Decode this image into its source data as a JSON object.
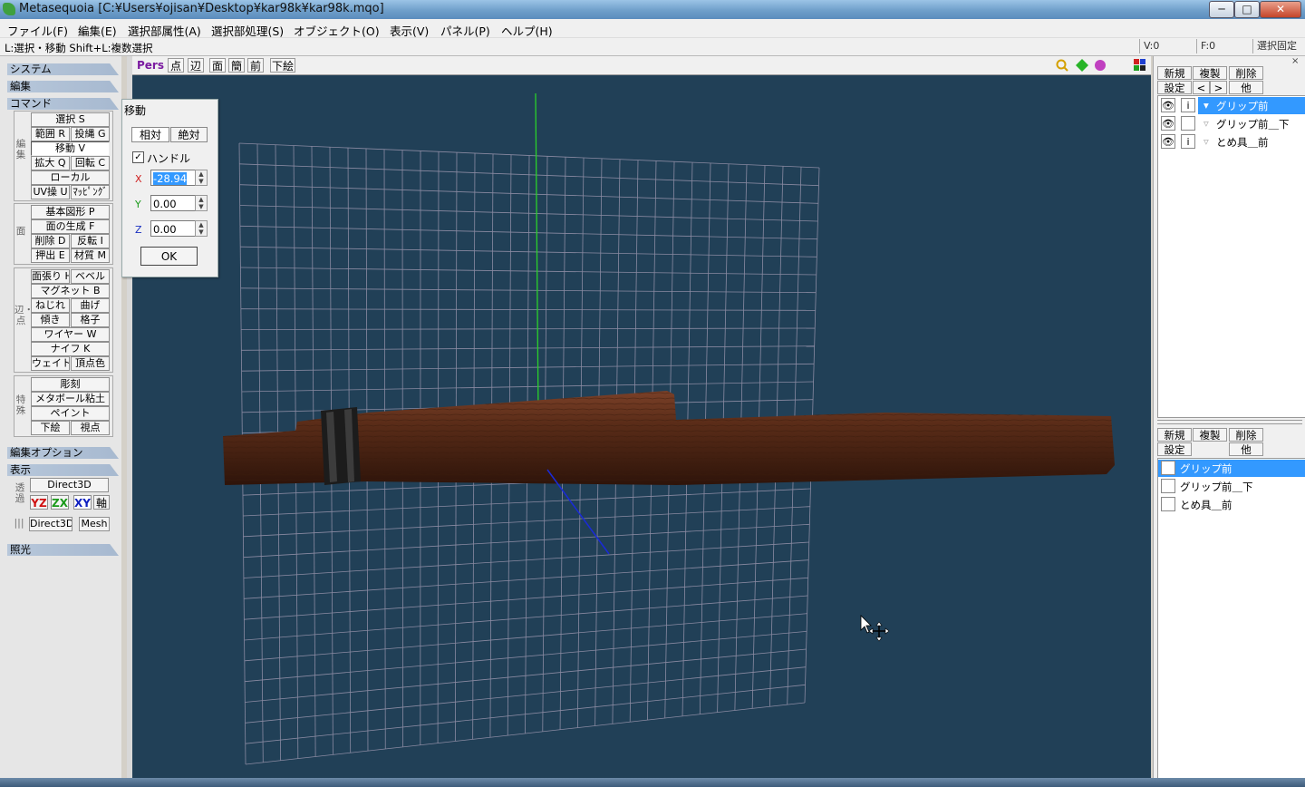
{
  "window": {
    "title": "Metasequoia [C:¥Users¥ojisan¥Desktop¥kar98k¥kar98k.mqo]",
    "min": "─",
    "max": "□",
    "close": "✕"
  },
  "menu": [
    "ファイル(F)",
    "編集(E)",
    "選択部属性(A)",
    "選択部処理(S)",
    "オブジェクト(O)",
    "表示(V)",
    "パネル(P)",
    "ヘルプ(H)"
  ],
  "status": {
    "hint": "L:選択・移動  Shift+L:複数選択",
    "vertex": "V:0",
    "face": "F:0",
    "lock": "選択固定"
  },
  "left": {
    "sections": {
      "system": "システム",
      "edit": "編集",
      "command": "コマンド",
      "edit_option": "編集オプション",
      "display": "表示",
      "light": "照光"
    },
    "group_labels": {
      "edit": "編集",
      "face": "面",
      "edge_vertex": "辺・点",
      "special": "特殊",
      "transparent": "透過"
    },
    "edit_buttons": {
      "select": "選択 S",
      "range": "範囲 R",
      "lasso": "投縄 G",
      "move": "移動 V",
      "scale": "拡大 Q",
      "rotate": "回転 C",
      "local": "ローカル",
      "uv": "UV操 U",
      "mapping": "ﾏｯﾋﾟﾝｸﾞ"
    },
    "face_buttons": {
      "primitive": "基本図形 P",
      "create_face": "面の生成 F",
      "delete": "削除 D",
      "flip": "反転 I",
      "extrude": "押出 E",
      "material": "材質 M"
    },
    "edge_buttons": {
      "stretch": "面張り H",
      "bevel": "ベベル",
      "magnet": "マグネット B",
      "twist": "ねじれ",
      "bend": "曲げ",
      "tilt": "傾き",
      "lattice": "格子",
      "wire": "ワイヤー W",
      "knife": "ナイフ K",
      "weight": "ウェイト",
      "vertex_color": "頂点色"
    },
    "special_buttons": {
      "sculpt": "彫刻",
      "metaball": "メタボール粘土",
      "paint": "ペイント",
      "underlay": "下絵",
      "viewpoint": "視点"
    },
    "display": {
      "direct3d": "Direct3D",
      "yz": "YZ",
      "zx": "ZX",
      "xy": "XY",
      "axis": "軸",
      "direct3d2": "Direct3D",
      "mesh": "Mesh",
      "sep": "|||"
    }
  },
  "viewport": {
    "buttons": {
      "pers": "Pers",
      "point": "点",
      "edge": "辺",
      "face": "面",
      "simple": "簡",
      "front": "前",
      "underlay": "下絵"
    }
  },
  "move_dialog": {
    "title": "移動",
    "relative": "相対",
    "absolute": "絶対",
    "handle_label": "ハンドル",
    "handle_checked": true,
    "x_label": "X",
    "y_label": "Y",
    "z_label": "Z",
    "x": "-28.94",
    "y": "0.00",
    "z": "0.00",
    "ok": "OK"
  },
  "object_panel": {
    "buttons": {
      "new": "新規",
      "copy": "複製",
      "delete": "削除",
      "settings": "設定",
      "prev": "<",
      "next": ">",
      "other": "他"
    },
    "objects": [
      {
        "name": "グリップ前"
      },
      {
        "name": "グリップ前＿下"
      },
      {
        "name": "とめ具＿前"
      }
    ]
  },
  "material_panel": {
    "buttons": {
      "new": "新規",
      "copy": "複製",
      "delete": "削除",
      "settings": "設定",
      "other": "他"
    },
    "materials": [
      {
        "name": "グリップ前"
      },
      {
        "name": "グリップ前＿下"
      },
      {
        "name": "とめ具＿前"
      }
    ]
  },
  "colors": {
    "viewport_bg": "#214057",
    "selection": "#3399ff",
    "wood": "#4a2414"
  }
}
